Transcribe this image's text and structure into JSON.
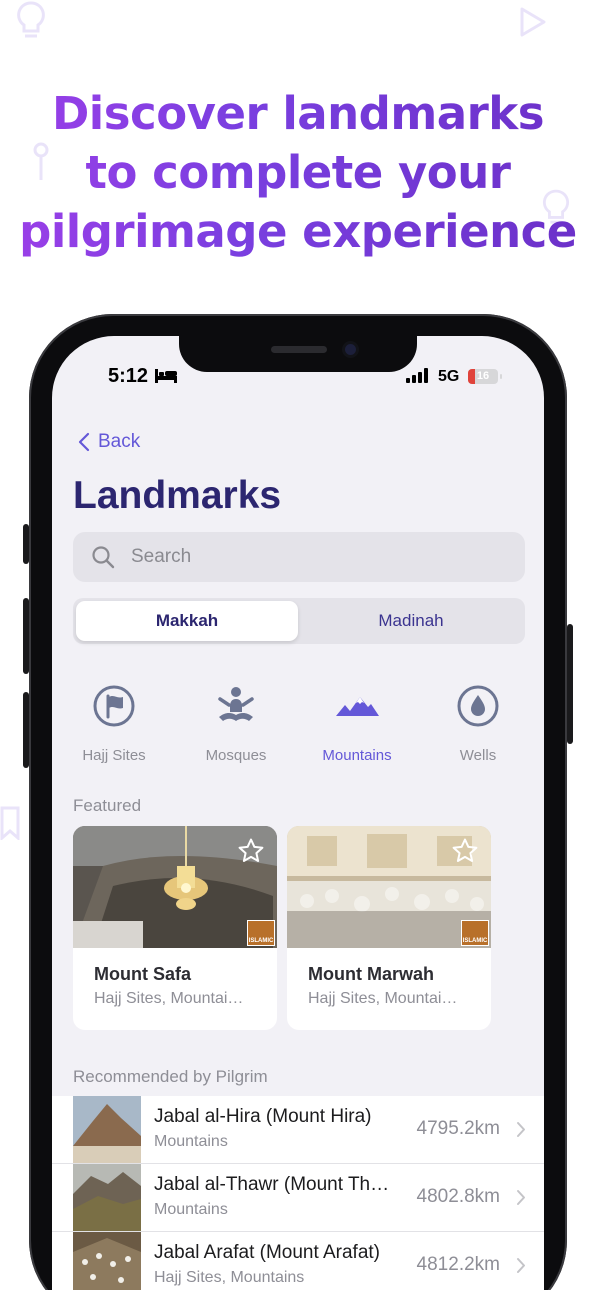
{
  "headline": {
    "line1": "Discover landmarks",
    "line2": "to complete your",
    "line3": "pilgrimage experience"
  },
  "status_bar": {
    "time": "5:12",
    "network": "5G",
    "battery": "16"
  },
  "nav": {
    "back_label": "Back",
    "title": "Landmarks"
  },
  "search": {
    "placeholder": "Search"
  },
  "segments": [
    {
      "label": "Makkah",
      "selected": true
    },
    {
      "label": "Madinah",
      "selected": false
    }
  ],
  "categories": [
    {
      "label": "Hajj Sites",
      "icon": "flag-icon",
      "selected": false
    },
    {
      "label": "Mosques",
      "icon": "praying-person-icon",
      "selected": false
    },
    {
      "label": "Mountains",
      "icon": "mountains-icon",
      "selected": true
    },
    {
      "label": "Wells",
      "icon": "water-drop-icon",
      "selected": false
    }
  ],
  "featured": {
    "heading": "Featured",
    "cards": [
      {
        "name": "Mount Safa",
        "subtitle": "Hajj Sites, Mountai…",
        "badge": "ISLAMIC"
      },
      {
        "name": "Mount Marwah",
        "subtitle": "Hajj Sites, Mountai…",
        "badge": "ISLAMIC"
      }
    ]
  },
  "recommended": {
    "heading": "Recommended by Pilgrim",
    "items": [
      {
        "name": "Jabal al-Hira (Mount Hira)",
        "category": "Mountains",
        "distance": "4795.2km"
      },
      {
        "name": "Jabal al-Thawr (Mount Th…",
        "category": "Mountains",
        "distance": "4802.8km"
      },
      {
        "name": "Jabal Arafat (Mount Arafat)",
        "category": "Hajj Sites, Mountains",
        "distance": "4812.2km"
      }
    ]
  },
  "colors": {
    "accent": "#6458d8",
    "title": "#2c2670",
    "headline_gradient_start": "#9b3fe8",
    "headline_gradient_end": "#6b30c8",
    "background": "#f2f1f6"
  }
}
